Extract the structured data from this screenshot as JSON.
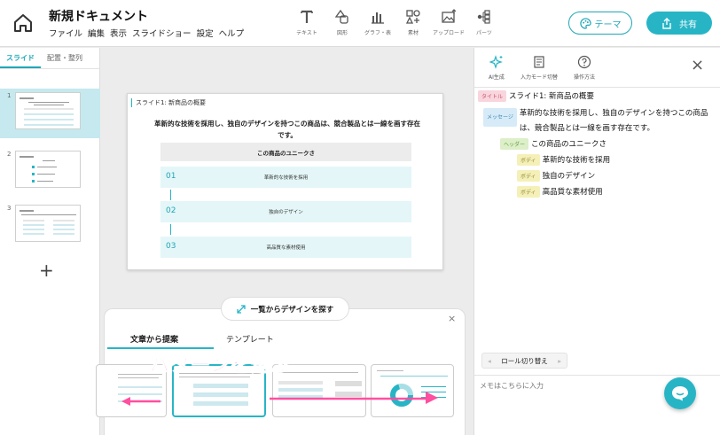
{
  "document": {
    "title": "新規ドキュメント"
  },
  "menu": [
    "ファイル",
    "編集",
    "表示",
    "スライドショー",
    "設定",
    "ヘルプ"
  ],
  "tools": [
    {
      "icon": "text-icon",
      "label": "テキスト"
    },
    {
      "icon": "shapes-icon",
      "label": "図形"
    },
    {
      "icon": "chart-icon",
      "label": "グラフ・表"
    },
    {
      "icon": "materials-icon",
      "label": "素材"
    },
    {
      "icon": "upload-icon",
      "label": "アップロード"
    },
    {
      "icon": "parts-icon",
      "label": "パーツ"
    }
  ],
  "header": {
    "theme_label": "テーマ",
    "share_label": "共有"
  },
  "left_panel": {
    "tabs": [
      "スライド",
      "配置・整列"
    ],
    "slide_numbers": [
      "1",
      "2",
      "3"
    ],
    "add_label": "+"
  },
  "slide": {
    "title": "スライド1: 新商品の概要",
    "message": "革新的な技術を採用し、独自のデザインを持つこの商品は、競合製品とは一線を画す存在です。",
    "header": "この商品のユニークさ",
    "items": [
      {
        "num": "01",
        "text": "革新的な技術を採用"
      },
      {
        "num": "02",
        "text": "独自のデザイン"
      },
      {
        "num": "03",
        "text": "高品質な素材使用"
      }
    ]
  },
  "design_panel": {
    "browse_label": "一覧からデザインを探す",
    "close_label": "×",
    "tabs": [
      "文章から提案",
      "テンプレート"
    ],
    "overlay_text": "パターンを選ぶ"
  },
  "right_panel": {
    "tools": [
      {
        "icon": "ai-sparkle-icon",
        "label": "AI生成"
      },
      {
        "icon": "input-mode-icon",
        "label": "入力モード切替"
      },
      {
        "icon": "help-icon",
        "label": "操作方法"
      }
    ],
    "close_label": "×",
    "outline": [
      {
        "tag": "タイトル",
        "text": "スライド1: 新商品の概要"
      },
      {
        "tag": "メッセージ",
        "text": "革新的な技術を採用し、独自のデザインを持つこの商品は、競合製品とは一線を画す存在です。"
      },
      {
        "tag": "ヘッダー",
        "text": "この商品のユニークさ"
      },
      {
        "tag": "ボディ",
        "text": "革新的な技術を採用"
      },
      {
        "tag": "ボディ",
        "text": "独自のデザイン"
      },
      {
        "tag": "ボディ",
        "text": "高品質な素材使用"
      }
    ],
    "role_switch_label": "ロール切り替え",
    "memo_placeholder": "メモはこちらに入力"
  },
  "colors": {
    "accent": "#27b5c6",
    "overlay_pink": "#ff4fa0"
  }
}
